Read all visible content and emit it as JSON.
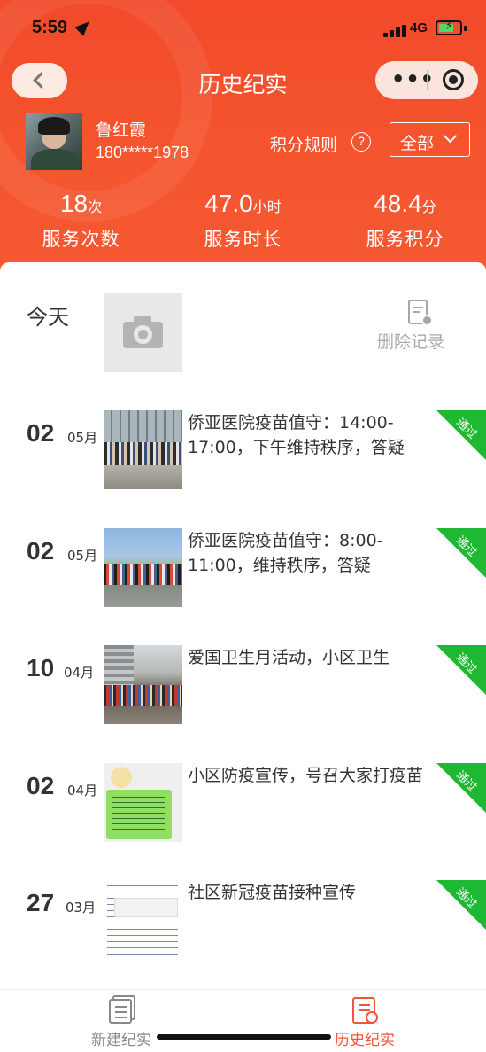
{
  "status_bar": {
    "time": "5:59",
    "network": "4G"
  },
  "header": {
    "title": "历史纪实"
  },
  "user": {
    "name": "鲁红霞",
    "phone": "180*****1978"
  },
  "rules": {
    "label": "积分规则",
    "icon": "?"
  },
  "filter": {
    "label": "全部"
  },
  "stats": [
    {
      "value": "18",
      "unit": "次",
      "label": "服务次数"
    },
    {
      "value": "47.0",
      "unit": "小时",
      "label": "服务时长"
    },
    {
      "value": "48.4",
      "unit": "分",
      "label": "服务积分"
    }
  ],
  "today": {
    "label": "今天",
    "delete_label": "删除记录"
  },
  "records": [
    {
      "day": "02",
      "month": "05月",
      "text": "侨亚医院疫苗值守：14:00-17:00，下午维持秩序，答疑",
      "status": "通过"
    },
    {
      "day": "02",
      "month": "05月",
      "text": "侨亚医院疫苗值守：8:00-11:00，维持秩序，答疑",
      "status": "通过"
    },
    {
      "day": "10",
      "month": "04月",
      "text": "爱国卫生月活动，小区卫生",
      "status": "通过"
    },
    {
      "day": "02",
      "month": "04月",
      "text": "小区防疫宣传，号召大家打疫苗",
      "status": "通过"
    },
    {
      "day": "27",
      "month": "03月",
      "text": "社区新冠疫苗接种宣传",
      "status": "通过"
    }
  ],
  "tabs": [
    {
      "label": "新建纪实",
      "color": "#888888"
    },
    {
      "label": "历史纪实",
      "color": "#f2553a"
    }
  ],
  "colors": {
    "brand": "#f24a2b",
    "approved": "#1fb833"
  }
}
